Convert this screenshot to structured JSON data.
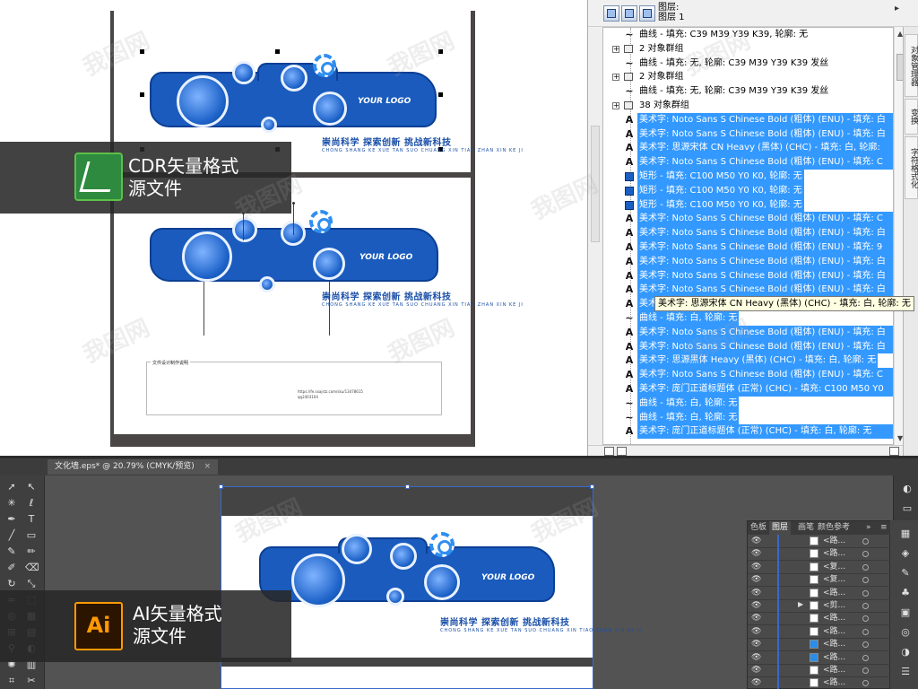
{
  "cdr_label": {
    "line1": "CDR矢量格式",
    "line2": "源文件"
  },
  "ai_label": {
    "line1": "AI矢量格式",
    "line2": "源文件"
  },
  "design": {
    "logo": "YOUR LOGO",
    "slogan": "崇尚科学 探索创新 挑战新科技",
    "slogan_pinyin": "CHONG SHANG KE XUE TAN SUO CHUANG XIN TIAO ZHAN XIN KE JI",
    "notes_title": "文件设计制作说明",
    "url": "https://fe.sxajstz.com/sku/13478615",
    "qq": "qq2403104"
  },
  "object_manager": {
    "layer_header_line1": "图层:",
    "layer_header_line2": "图层 1",
    "rows": [
      {
        "type": "curve",
        "text": "曲线 - 填充: C39 M39 Y39 K39, 轮廓: 无",
        "selected": false
      },
      {
        "type": "group",
        "text": "2 对象群组",
        "selected": false
      },
      {
        "type": "curve",
        "text": "曲线 - 填充: 无, 轮廓: C39 M39 Y39 K39 发丝",
        "selected": false
      },
      {
        "type": "group",
        "text": "2 对象群组",
        "selected": false
      },
      {
        "type": "curve",
        "text": "曲线 - 填充: 无, 轮廓: C39 M39 Y39 K39 发丝",
        "selected": false
      },
      {
        "type": "group",
        "text": "38 对象群组",
        "selected": false
      },
      {
        "type": "art",
        "text": "美术字: Noto Sans S Chinese Bold (粗体) (ENU) - 填充: 白",
        "selected": true
      },
      {
        "type": "art",
        "text": "美术字: Noto Sans S Chinese Bold (粗体) (ENU) - 填充: 白",
        "selected": true
      },
      {
        "type": "art",
        "text": "美术字: 思源宋体 CN Heavy (黑体) (CHC) - 填充: 白, 轮廓:",
        "selected": true
      },
      {
        "type": "art",
        "text": "美术字: Noto Sans S Chinese Bold (粗体) (ENU) - 填充: C",
        "selected": true
      },
      {
        "type": "rect",
        "text": "矩形 - 填充: C100 M50 Y0 K0, 轮廓: 无",
        "selected": true,
        "short": true
      },
      {
        "type": "rect",
        "text": "矩形 - 填充: C100 M50 Y0 K0, 轮廓: 无",
        "selected": true,
        "short": true
      },
      {
        "type": "rect",
        "text": "矩形 - 填充: C100 M50 Y0 K0, 轮廓: 无",
        "selected": true,
        "short": true
      },
      {
        "type": "art",
        "text": "美术字: Noto Sans S Chinese Bold (粗体) (ENU) - 填充: C",
        "selected": true
      },
      {
        "type": "art",
        "text": "美术字: Noto Sans S Chinese Bold (粗体) (ENU) - 填充: 白",
        "selected": true
      },
      {
        "type": "art",
        "text": "美术字: Noto Sans S Chinese Bold (粗体) (ENU) - 填充: 9",
        "selected": true
      },
      {
        "type": "art",
        "text": "美术字: Noto Sans S Chinese Bold (粗体) (ENU) - 填充: 白",
        "selected": true
      },
      {
        "type": "art",
        "text": "美术字: Noto Sans S Chinese Bold (粗体) (ENU) - 填充: 白",
        "selected": true
      },
      {
        "type": "art",
        "text": "美术字: Noto Sans S Chinese Bold (粗体) (ENU) - 填充: 白",
        "selected": true
      },
      {
        "type": "art",
        "text": "美术字: 思源宋体 CN Heavy (黑体) (CHC) - 填充: 白, 轮廓: 无",
        "selected": true
      },
      {
        "type": "curve",
        "text": "曲线 - 填充: 白, 轮廓: 无",
        "selected": true,
        "short": true
      },
      {
        "type": "art",
        "text": "美术字: Noto Sans S Chinese Bold (粗体) (ENU) - 填充: 白",
        "selected": true
      },
      {
        "type": "art",
        "text": "美术字: Noto Sans S Chinese Bold (粗体) (ENU) - 填充: 白",
        "selected": true
      },
      {
        "type": "art",
        "text": "美术字: 思源黑体 Heavy (黑体) (CHC) - 填充: 白, 轮廓: 无",
        "selected": true,
        "short": true
      },
      {
        "type": "art",
        "text": "美术字: Noto Sans S Chinese Bold (粗体) (ENU) - 填充: C",
        "selected": true
      },
      {
        "type": "art",
        "text": "美术字: 庞门正道标题体 (正常) (CHC) - 填充: C100 M50 Y0",
        "selected": true
      },
      {
        "type": "curve",
        "text": "曲线 - 填充: 白, 轮廓: 无",
        "selected": true,
        "short": true
      },
      {
        "type": "curve",
        "text": "曲线 - 填充: 白, 轮廓: 无",
        "selected": true,
        "short": true
      },
      {
        "type": "art",
        "text": "美术字: 庞门正道标题体 (正常) (CHC) - 填充: 白, 轮廓: 无",
        "selected": true
      }
    ],
    "tooltip": "美术字: 思源宋体 CN Heavy (黑体) (CHC) - 填充: 白, 轮廓: 无"
  },
  "docker_tabs": [
    "对象管理器",
    "变换",
    "字符格式化"
  ],
  "ai": {
    "doc_tab": "文化墙.eps* @ 20.79% (CMYK/预览)",
    "layers_tabs": [
      "色板",
      "图层",
      "画笔",
      "颜色参考"
    ],
    "layer_rows": [
      {
        "name": "<路...",
        "thumb": "white"
      },
      {
        "name": "<路...",
        "thumb": "white"
      },
      {
        "name": "<复...",
        "thumb": "white"
      },
      {
        "name": "<复...",
        "thumb": "white"
      },
      {
        "name": "<路...",
        "thumb": "white"
      },
      {
        "name": "<剪...",
        "thumb": "white",
        "arrow": true
      },
      {
        "name": "<路...",
        "thumb": "white"
      },
      {
        "name": "<路...",
        "thumb": "white"
      },
      {
        "name": "<路...",
        "thumb": "blue"
      },
      {
        "name": "<路...",
        "thumb": "blue"
      },
      {
        "name": "<路...",
        "thumb": "white"
      },
      {
        "name": "<路...",
        "thumb": "white"
      }
    ]
  },
  "watermark": "我图网",
  "colors": {
    "brand_blue": "#1a5bbd",
    "selection": "#3399ff"
  }
}
